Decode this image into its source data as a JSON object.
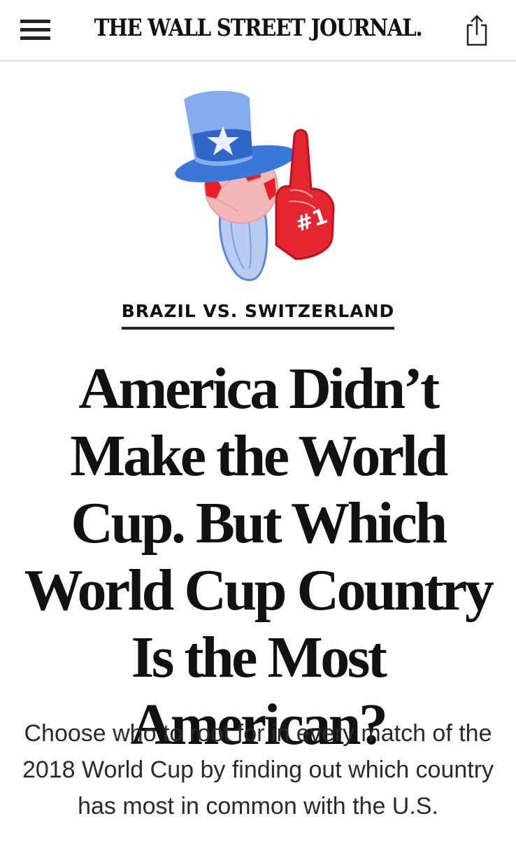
{
  "header": {
    "logo_text": "THE WALL STREET JOURNAL.",
    "menu_icon": "hamburger-menu-icon",
    "share_icon": "share-icon"
  },
  "article": {
    "kicker": "BRAZIL VS. SWITZERLAND",
    "headline": "America Didn’t Make the World Cup. But Which World Cup Country Is the Most American?",
    "dek": "Choose who to root for in every match of the 2018 World Cup by finding out which country has most in common with the U.S.",
    "hero_image": {
      "foam_finger_text": "#1"
    }
  },
  "colors": {
    "accent_blue": "#3a78d8",
    "accent_red": "#e02a2a",
    "text": "#111111",
    "divider": "#d6d6d6"
  }
}
